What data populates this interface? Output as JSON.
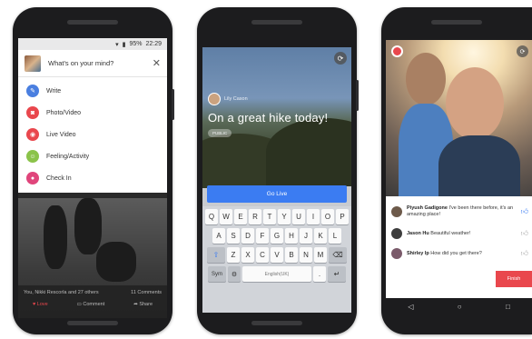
{
  "phone1": {
    "status": {
      "battery": "95%",
      "time": "22:29"
    },
    "composer": {
      "prompt": "What's on your mind?",
      "close": "✕"
    },
    "menu": [
      {
        "label": "Write",
        "icon": "pencil-icon",
        "color": "#4a7fe0",
        "glyph": "✎"
      },
      {
        "label": "Photo/Video",
        "icon": "camera-icon",
        "color": "#e9474d",
        "glyph": "◙"
      },
      {
        "label": "Live Video",
        "icon": "live-video-icon",
        "color": "#e9474d",
        "glyph": "◉"
      },
      {
        "label": "Feeling/Activity",
        "icon": "smiley-icon",
        "color": "#8bc34a",
        "glyph": "☺"
      },
      {
        "label": "Check In",
        "icon": "location-pin-icon",
        "color": "#e0457b",
        "glyph": "●"
      }
    ],
    "feed": {
      "reactions": "You, Nikki Rescorla and 27 others",
      "comments": "11 Comments",
      "actions": [
        "Love",
        "Comment",
        "Share"
      ]
    }
  },
  "phone2": {
    "user_name": "Lily Cason",
    "post_title": "On a great hike today!",
    "audience": "PUBLIC",
    "go_live": "Go Live",
    "keyboard": {
      "row1": [
        "Q",
        "W",
        "E",
        "R",
        "T",
        "Y",
        "U",
        "I",
        "O",
        "P"
      ],
      "row2": [
        "A",
        "S",
        "D",
        "F",
        "G",
        "H",
        "J",
        "K",
        "L"
      ],
      "row3": [
        "Z",
        "X",
        "C",
        "V",
        "B",
        "N",
        "M"
      ],
      "shift": "⇧",
      "backspace": "⌫",
      "sym": "Sym",
      "settings": "⚙",
      "space": "English(UK)",
      "period": ".",
      "enter": "↵"
    }
  },
  "phone3": {
    "comments": [
      {
        "name": "Piyush Gadigone",
        "text": "I've been there before, it's an amazing place!",
        "liked": true,
        "avatar_color": "#6d5a4a"
      },
      {
        "name": "Jason Hu",
        "text": "Beautiful weather!",
        "liked": false,
        "avatar_color": "#3d3d3d"
      },
      {
        "name": "Shirley Ip",
        "text": "How did you get there?",
        "liked": false,
        "avatar_color": "#7a5a6a"
      }
    ],
    "finish": "Finish",
    "nav": [
      "◁",
      "○",
      "□"
    ]
  },
  "colors": {
    "facebook_blue": "#3b7cf2",
    "live_red": "#e9474d"
  }
}
